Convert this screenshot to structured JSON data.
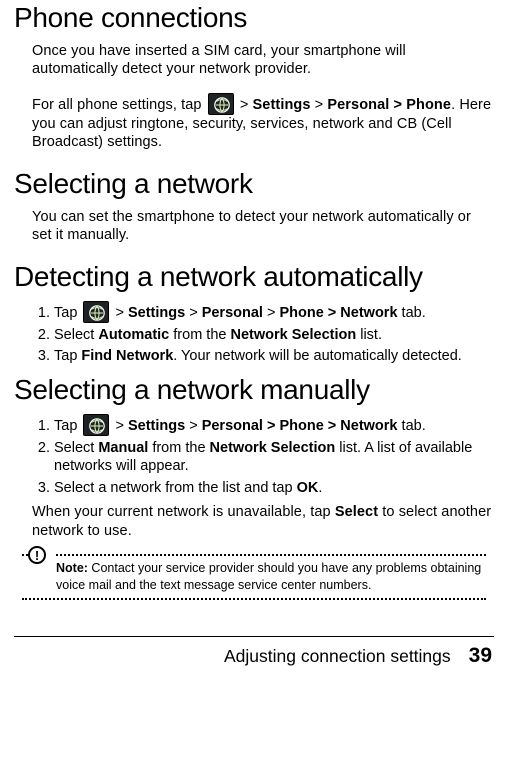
{
  "headings": {
    "h1a": "Phone connections",
    "h1b": "Selecting a network",
    "h1c": "Detecting a network automatically",
    "h1d": "Selecting a network manually"
  },
  "para": {
    "intro": "Once you have inserted a SIM card, your smartphone will automatically detect your network provider.",
    "path_pre": "For all phone settings, tap ",
    "path_sep": " > ",
    "path_settings": "Settings",
    "path_personal_phone": "Personal > Phone",
    "path_post": ". Here you can adjust ringtone, security, services, network and CB (Cell Broadcast) settings.",
    "network_intro": "You can set the smartphone to detect your network automatically or set it manually.",
    "after_manual": "When your current network is unavailable, tap ",
    "after_manual_bold": "Select",
    "after_manual_tail": " to select another network to use."
  },
  "auto_steps": {
    "s1_pre": "Tap ",
    "s1_settings": "Settings",
    "s1_personal": "Personal",
    "s1_phone_net": "Phone > Network",
    "s1_tab": " tab.",
    "s2_pre": "Select ",
    "s2_bold1": "Automatic",
    "s2_mid": " from the ",
    "s2_bold2": "Network Selection",
    "s2_tail": " list.",
    "s3_pre": "Tap ",
    "s3_bold": "Find Network",
    "s3_tail": ". Your network will be automatically detected."
  },
  "manual_steps": {
    "s1_pre": "Tap ",
    "s1_settings": "Settings",
    "s1_personal_phone_net": "Personal > Phone > Network",
    "s1_tab": " tab.",
    "s2_pre": "Select ",
    "s2_bold1": "Manual",
    "s2_mid": " from the ",
    "s2_bold2": "Network Selection",
    "s2_tail": " list. A list of available networks will appear.",
    "s3_pre": "Select a network from the list and tap ",
    "s3_bold": "OK",
    "s3_tail": "."
  },
  "note": {
    "label": "Note:",
    "text": " Contact your service provider should you have any problems obtaining voice mail and the text message service center numbers."
  },
  "footer": {
    "title": "Adjusting connection settings",
    "page": "39"
  }
}
